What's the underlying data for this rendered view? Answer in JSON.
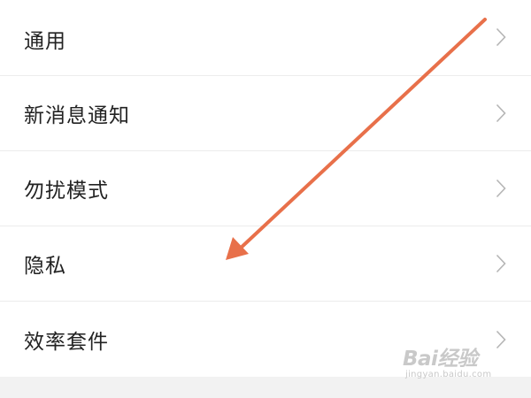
{
  "settings": {
    "items": [
      {
        "label": "通用",
        "icon": "chevron-right-icon"
      },
      {
        "label": "新消息通知",
        "icon": "chevron-right-icon"
      },
      {
        "label": "勿扰模式",
        "icon": "chevron-right-icon"
      },
      {
        "label": "隐私",
        "icon": "chevron-right-icon"
      },
      {
        "label": "效率套件",
        "icon": "chevron-right-icon"
      }
    ]
  },
  "watermark": {
    "logo_text": "Bai经验",
    "url_text": "jingyan.baidu.com"
  },
  "annotation": {
    "arrow_color": "#E8704A",
    "icon": "arrow-annotation-icon"
  },
  "colors": {
    "background": "#ffffff",
    "text": "#222222",
    "divider": "#ececec",
    "chevron": "#b5b5b5",
    "footer": "#f2f2f2"
  }
}
